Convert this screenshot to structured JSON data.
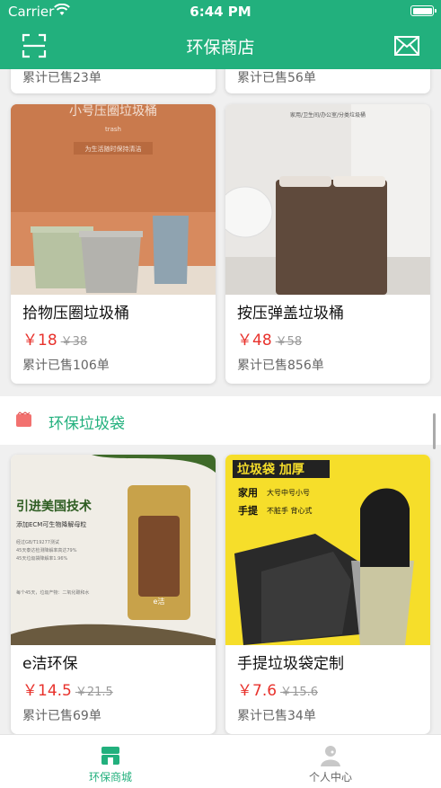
{
  "status_bar": {
    "carrier": "Carrier",
    "time": "6:44 PM"
  },
  "nav": {
    "title": "环保商店"
  },
  "colors": {
    "brand": "#22b07d",
    "price": "#e8322c",
    "tab_inactive": "#c8c8c8"
  },
  "products_partial": [
    {
      "sold": "累计已售23单"
    },
    {
      "sold": "累计已售56单"
    }
  ],
  "products_bins": [
    {
      "name": "拾物压圈垃圾桶",
      "price": "￥18",
      "original_price": "￥38",
      "sold": "累计已售106单",
      "image_text": {
        "headline": "小号压圈垃圾桶",
        "logo": "trash",
        "tagline": "为生活随时保持清洁"
      }
    },
    {
      "name": "按压弹盖垃圾桶",
      "price": "￥48",
      "original_price": "￥58",
      "sold": "累计已售856单",
      "image_text": {
        "caption": "家用/卫生间/办公室/分类垃圾桶"
      }
    }
  ],
  "section": {
    "title": "环保垃圾袋",
    "icon": "bag-icon"
  },
  "products_bags": [
    {
      "name": "e洁环保",
      "price": "￥14.5",
      "original_price": "￥21.5",
      "sold": "累计已售69单",
      "image_text": {
        "headline": "引进美国技术",
        "sub": "添加ECM可生物降解母粒",
        "line1": "经过GB/T19277测试",
        "line2": "45天泰达检测降解率高达79%",
        "line3": "45天垃圾袋降解率1.96%",
        "line4": "每个45天，垃圾产物：二氧化碳和水",
        "bag_label": "e洁"
      }
    },
    {
      "name": "手提垃圾袋定制",
      "price": "￥7.6",
      "original_price": "￥15.6",
      "sold": "累计已售34单",
      "image_text": {
        "headline": "垃圾袋 加厚",
        "row1_label": "家用",
        "row1_text": "大号中号小号",
        "row2_label": "手提",
        "row2_text": "不脏手 背心式"
      }
    }
  ],
  "tabbar": {
    "tabs": [
      {
        "label": "环保商城",
        "icon": "store-icon",
        "active": true
      },
      {
        "label": "个人中心",
        "icon": "user-icon",
        "active": false
      }
    ]
  }
}
